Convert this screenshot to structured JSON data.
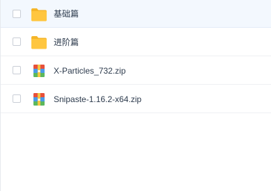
{
  "files": [
    {
      "name": "基础篇",
      "type": "folder",
      "hovered": true
    },
    {
      "name": "进阶篇",
      "type": "folder",
      "hovered": false
    },
    {
      "name": "X-Particles_732.zip",
      "type": "zip",
      "hovered": false
    },
    {
      "name": "Snipaste-1.16.2-x64.zip",
      "type": "zip",
      "hovered": false
    }
  ],
  "colors": {
    "folder": "#ffc63f",
    "hover_background": "#f3f8fe",
    "text": "#2c3a4c"
  }
}
